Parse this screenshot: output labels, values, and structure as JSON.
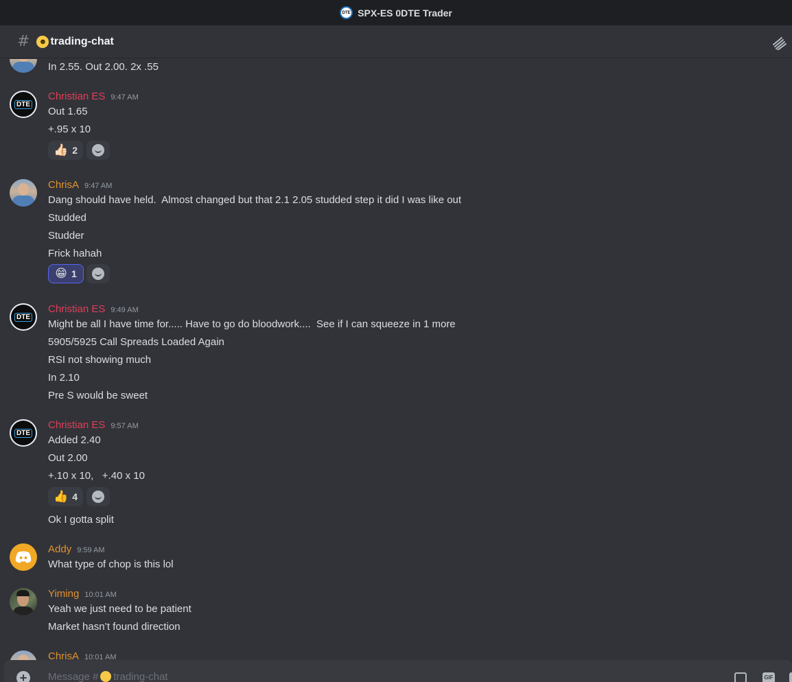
{
  "window": {
    "title": "SPX-ES 0DTE Trader",
    "server_logo_text": "DTE"
  },
  "channel": {
    "name": "trading-chat",
    "emoji": "grinning-face-emoji"
  },
  "colors": {
    "background": "#323339",
    "titlebar": "#1e1f22",
    "name_red": "#e23e57",
    "name_orange": "#e0922f"
  },
  "messages": [
    {
      "lines": [
        "In 2.55. Out 2.00. 2x .55"
      ]
    },
    {
      "author": "Christian ES",
      "time": "9:47 AM",
      "avatar_text": "DTE",
      "lines": [
        "Out 1.65",
        "+.95 x 10"
      ],
      "reactions": [
        {
          "emoji": "👍🏻",
          "count": "2"
        }
      ]
    },
    {
      "author": "ChrisA",
      "time": "9:47 AM",
      "lines": [
        "Dang should have held.  Almost changed but that 2.1 2.05 studded step it did I was like out",
        "Studded",
        "Studder",
        "Frick hahah"
      ],
      "reactions": [
        {
          "emoji": "😁",
          "count": "1"
        }
      ]
    },
    {
      "author": "Christian ES",
      "time": "9:49 AM",
      "avatar_text": "DTE",
      "lines": [
        "Might be all I have time for..... Have to go do bloodwork....  See if I can squeeze in 1 more",
        "5905/5925 Call Spreads Loaded Again",
        "RSI not showing much",
        "In 2.10",
        "Pre S would be sweet"
      ]
    },
    {
      "author": "Christian ES",
      "time": "9:57 AM",
      "avatar_text": "DTE",
      "lines": [
        "Added 2.40",
        "Out 2.00",
        "+.10 x 10,   +.40 x 10",
        "Ok I gotta split"
      ],
      "reactions": [
        {
          "emoji": "👍",
          "count": "4"
        }
      ]
    },
    {
      "author": "Addy",
      "time": "9:59 AM",
      "lines": [
        "What type of chop is this lol"
      ]
    },
    {
      "author": "Yiming",
      "time": "10:01 AM",
      "lines": [
        "Yeah we just need to be patient",
        "Market hasn’t found direction"
      ]
    },
    {
      "author": "ChrisA",
      "time": "10:01 AM"
    }
  ],
  "composer": {
    "placeholder_prefix": "Message #",
    "placeholder_channel": "trading-chat",
    "gif_label": "GIF"
  }
}
